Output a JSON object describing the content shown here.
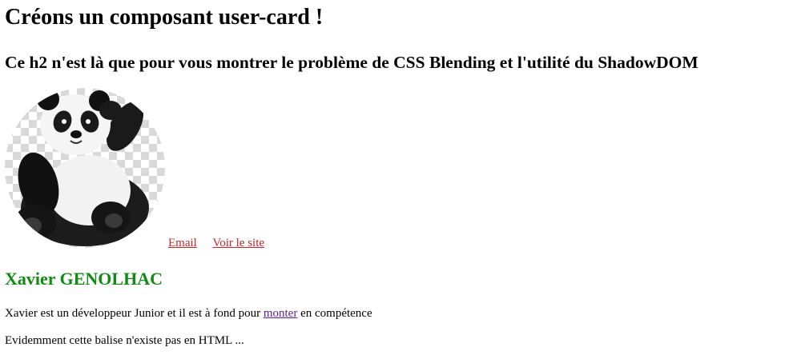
{
  "page": {
    "title": "Créons un composant user-card !",
    "subtitle": "Ce h2 n'est là que pour vous montrer le problème de CSS Blending et l'utilité du ShadowDOM"
  },
  "card": {
    "avatar_icon": "panda-avatar",
    "links": {
      "email": "Email",
      "site": "Voir le site"
    },
    "name": "Xavier GENOLHAC",
    "bio": {
      "before": "Xavier est un développeur Junior et il est à fond pour ",
      "link": "monter",
      "after": " en compétence"
    },
    "note": "Evidemment cette balise n'existe pas en HTML ..."
  },
  "colors": {
    "link": "#c1272d",
    "visited_link": "#5a1f8e",
    "name": "#118a11"
  }
}
